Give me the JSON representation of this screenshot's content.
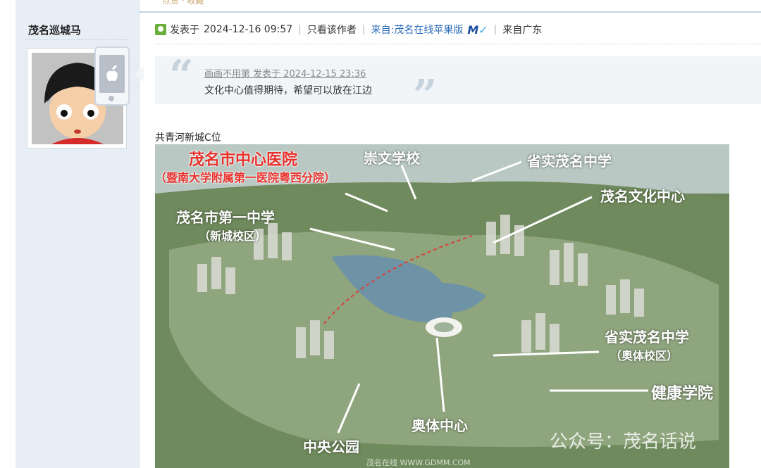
{
  "prev_post": {
    "ghost_text": "点赞 · 收藏"
  },
  "user": {
    "name": "茂名巡城马"
  },
  "post_meta": {
    "posted_prefix": "发表于",
    "posted_time": "2024-12-16 09:57",
    "only_author": "只看该作者",
    "from_client": "来自:茂名在线苹果版",
    "from_region": "来自广东"
  },
  "quote": {
    "author_line": "画画不用第 发表于 2024-12-15 23:36",
    "text": "文化中心值得期待，希望可以放在江边"
  },
  "post": {
    "caption": "共青河新城C位",
    "image_labels": {
      "hospital": "茂名市中心医院",
      "hospital_sub": "（暨南大学附属第一医院粤西分院）",
      "chongwen": "崇文学校",
      "shengshi_top": "省实茂名中学",
      "culture_center": "茂名文化中心",
      "first_middle": "茂名市第一中学",
      "first_middle_sub": "（新城校区）",
      "shengshi_olympic": "省实茂名中学",
      "shengshi_olympic_sub": "（奥体校区）",
      "health_college": "健康学院",
      "olympic_center": "奥体中心",
      "central_park": "中央公园",
      "watermark": "公众号：茂名话说",
      "site_watermark": "茂名在线 WWW.GDMM.COM"
    }
  },
  "colors": {
    "link": "#2b6cb8",
    "hospital_label": "#e8322e",
    "sidebar_bg": "#e7eef5"
  }
}
